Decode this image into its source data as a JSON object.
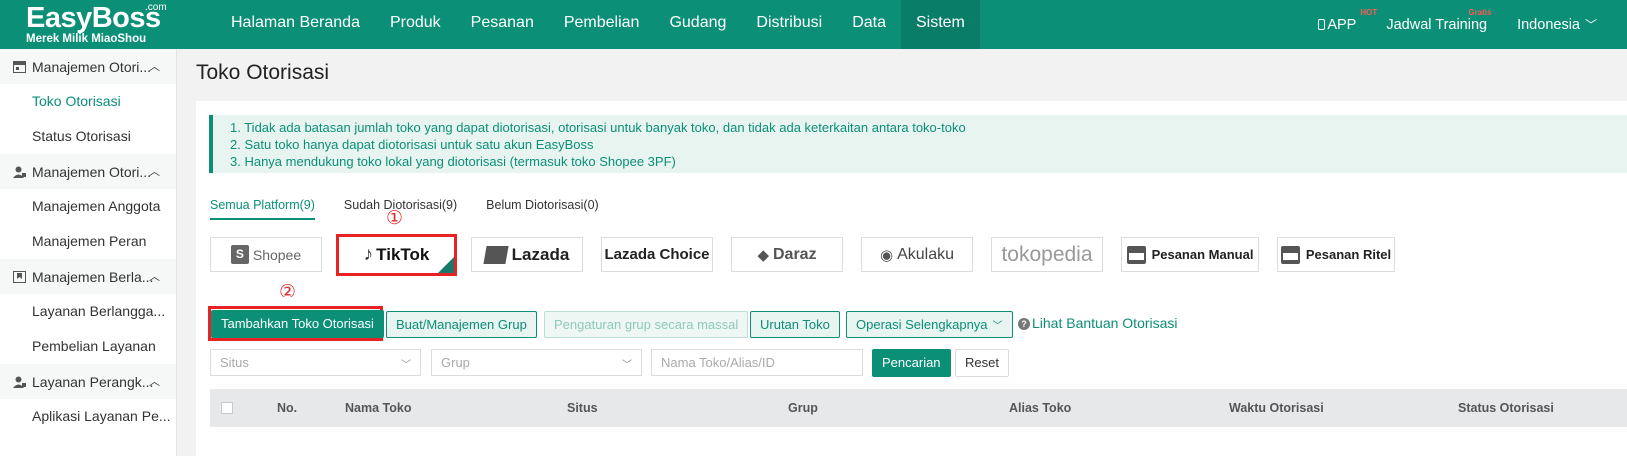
{
  "brand": {
    "name": "EasyBoss",
    "com": ".com",
    "subtitle": "Merek Milik MiaoShou"
  },
  "nav": [
    "Halaman Beranda",
    "Produk",
    "Pesanan",
    "Pembelian",
    "Gudang",
    "Distribusi",
    "Data",
    "Sistem"
  ],
  "nav_active": "Sistem",
  "top_right": {
    "app": "APP",
    "app_badge": "HOT",
    "training": "Jadwal Training",
    "training_badge": "Gratis",
    "language": "Indonesia"
  },
  "sidebar": {
    "groups": [
      {
        "label": "Manajemen Otori...",
        "icon": "store-icon",
        "items": [
          "Toko Otorisasi",
          "Status Otorisasi"
        ]
      },
      {
        "label": "Manajemen Otori...",
        "icon": "user-icon",
        "items": [
          "Manajemen Anggota",
          "Manajemen Peran"
        ]
      },
      {
        "label": "Manajemen Berla...",
        "icon": "bookmark-icon",
        "items": [
          "Layanan Berlangga...",
          "Pembelian Layanan"
        ]
      },
      {
        "label": "Layanan Perangk...",
        "icon": "user-icon",
        "items": [
          "Aplikasi Layanan Pe..."
        ]
      }
    ],
    "active_item": "Toko Otorisasi"
  },
  "page": {
    "title": "Toko Otorisasi"
  },
  "notice": [
    "1. Tidak ada batasan jumlah toko yang dapat diotorisasi, otorisasi untuk banyak toko, dan tidak ada keterkaitan antara toko-toko",
    "2. Satu toko hanya dapat diotorisasi untuk satu akun EasyBoss",
    "3. Hanya mendukung toko lokal yang diotorisasi (termasuk toko Shopee 3PF)"
  ],
  "platform_tabs": [
    "Semua Platform(9)",
    "Sudah Diotorisasi(9)",
    "Belum Diotorisasi(0)"
  ],
  "annotations": {
    "one": "①",
    "two": "②"
  },
  "platforms": [
    "Shopee",
    "TikTok",
    "Lazada",
    "Lazada Choice",
    "Daraz",
    "Akulaku",
    "tokopedia",
    "Pesanan Manual",
    "Pesanan Ritel"
  ],
  "actions": {
    "add": "Tambahkan Toko Otorisasi",
    "group": "Buat/Manajemen Grup",
    "bulk_group": "Pengaturan grup secara massal",
    "order": "Urutan Toko",
    "more": "Operasi Selengkapnya",
    "help": "Lihat Bantuan Otorisasi"
  },
  "filters": {
    "site_placeholder": "Situs",
    "group_placeholder": "Grup",
    "name_placeholder": "Nama Toko/Alias/ID",
    "search": "Pencarian",
    "reset": "Reset"
  },
  "table_headers": [
    "No.",
    "Nama Toko",
    "Situs",
    "Grup",
    "Alias Toko",
    "Waktu Otorisasi",
    "Status Otorisasi"
  ],
  "colors": {
    "brand": "#0b8f77",
    "highlight": "#e82224"
  }
}
